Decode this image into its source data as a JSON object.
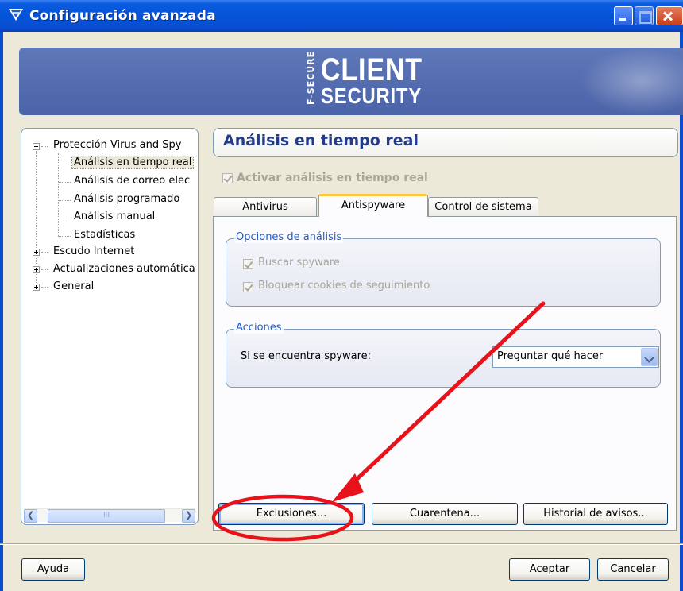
{
  "window": {
    "title": "Configuración avanzada"
  },
  "banner": {
    "brand_small": "F-SECURE",
    "brand_line1": "CLIENT",
    "brand_line2": "SECURITY"
  },
  "tree": {
    "root_label": "Protección Virus and Spy",
    "children": [
      "Análisis en tiempo real",
      "Análisis de correo elec",
      "Análisis programado",
      "Análisis manual",
      "Estadísticas"
    ],
    "siblings": [
      "Escudo Internet",
      "Actualizaciones automática",
      "General"
    ],
    "scroll_grip": "III"
  },
  "content": {
    "header": "Análisis en tiempo real",
    "enable_checkbox_label": "Activar análisis en tiempo real",
    "tabs": [
      "Antivirus",
      "Antispyware",
      "Control de sistema"
    ],
    "active_tab": "Antispyware",
    "group_options": {
      "legend": "Opciones de análisis",
      "check1": "Buscar spyware",
      "check2": "Bloquear cookies de seguimiento"
    },
    "group_actions": {
      "legend": "Acciones",
      "label": "Si se encuentra spyware:",
      "select_value": "Preguntar qué hacer"
    },
    "buttons": {
      "exclusions": "Exclusiones...",
      "quarantine": "Cuarentena...",
      "history": "Historial de avisos..."
    }
  },
  "footer": {
    "help": "Ayuda",
    "ok": "Aceptar",
    "cancel": "Cancelar"
  },
  "colors": {
    "title_bar": "#0a5be0",
    "header_text": "#243c87",
    "group_legend": "#1d5bd6",
    "annotation": "#e8121a",
    "banner": "#5068ac"
  }
}
